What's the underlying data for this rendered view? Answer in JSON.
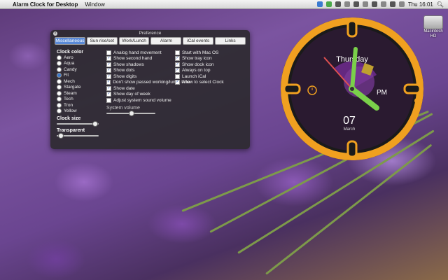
{
  "menubar": {
    "app_name": "Alarm Clock for Desktop",
    "menu_window": "Window",
    "time": "Thu 16:01"
  },
  "desktop": {
    "hd_label_line1": "Macintosh",
    "hd_label_line2": "HD"
  },
  "preference": {
    "title": "Preference",
    "tabs": [
      {
        "label": "Miscellaneous",
        "active": true
      },
      {
        "label": "Sun rise/set",
        "active": false
      },
      {
        "label": "Work/Lunch",
        "active": false
      },
      {
        "label": "Alarm",
        "active": false
      },
      {
        "label": "iCal events",
        "active": false
      },
      {
        "label": "Links",
        "active": false
      }
    ],
    "clock_color_label": "Clock color",
    "colors": [
      {
        "label": "Aero",
        "selected": false
      },
      {
        "label": "Aqua",
        "selected": false
      },
      {
        "label": "Candy",
        "selected": false
      },
      {
        "label": "Fit",
        "selected": true
      },
      {
        "label": "Mech",
        "selected": false
      },
      {
        "label": "Stargate",
        "selected": false
      },
      {
        "label": "Steam",
        "selected": false
      },
      {
        "label": "Tech",
        "selected": false
      },
      {
        "label": "Tron",
        "selected": false
      },
      {
        "label": "Yellow",
        "selected": false
      }
    ],
    "clock_size_label": "Clock size",
    "transparent_label": "Transparent",
    "clock_size_value": 0.95,
    "transparent_value": 0.03,
    "options_col1": [
      {
        "label": "Analog hand movement",
        "checked": false
      },
      {
        "label": "Show second hand",
        "checked": true
      },
      {
        "label": "Show shadows",
        "checked": true
      },
      {
        "label": "Show dots",
        "checked": true
      },
      {
        "label": "Show digits",
        "checked": true
      },
      {
        "label": "Don't show passed working/lunch time",
        "checked": true
      },
      {
        "label": "Show date",
        "checked": true
      },
      {
        "label": "Show day of week",
        "checked": true
      },
      {
        "label": "Adjust system sound volume",
        "checked": false
      }
    ],
    "options_col2": [
      {
        "label": "Start with Mac OS",
        "checked": false
      },
      {
        "label": "Show tray icon",
        "checked": true
      },
      {
        "label": "Show dock icon",
        "checked": true
      },
      {
        "label": "Always on top",
        "checked": true
      },
      {
        "label": "Launch iCal",
        "checked": false
      },
      {
        "label": "Allow to select Clock",
        "checked": true
      }
    ],
    "system_volume_label": "System volume",
    "system_volume_value": 0.5
  },
  "clock": {
    "day": "Thursday",
    "ampm": "PM",
    "date_num": "07",
    "month": "March",
    "ring_color": "#f0a020",
    "face_color": "#2a1a30",
    "hand_color": "#7ad04a"
  }
}
